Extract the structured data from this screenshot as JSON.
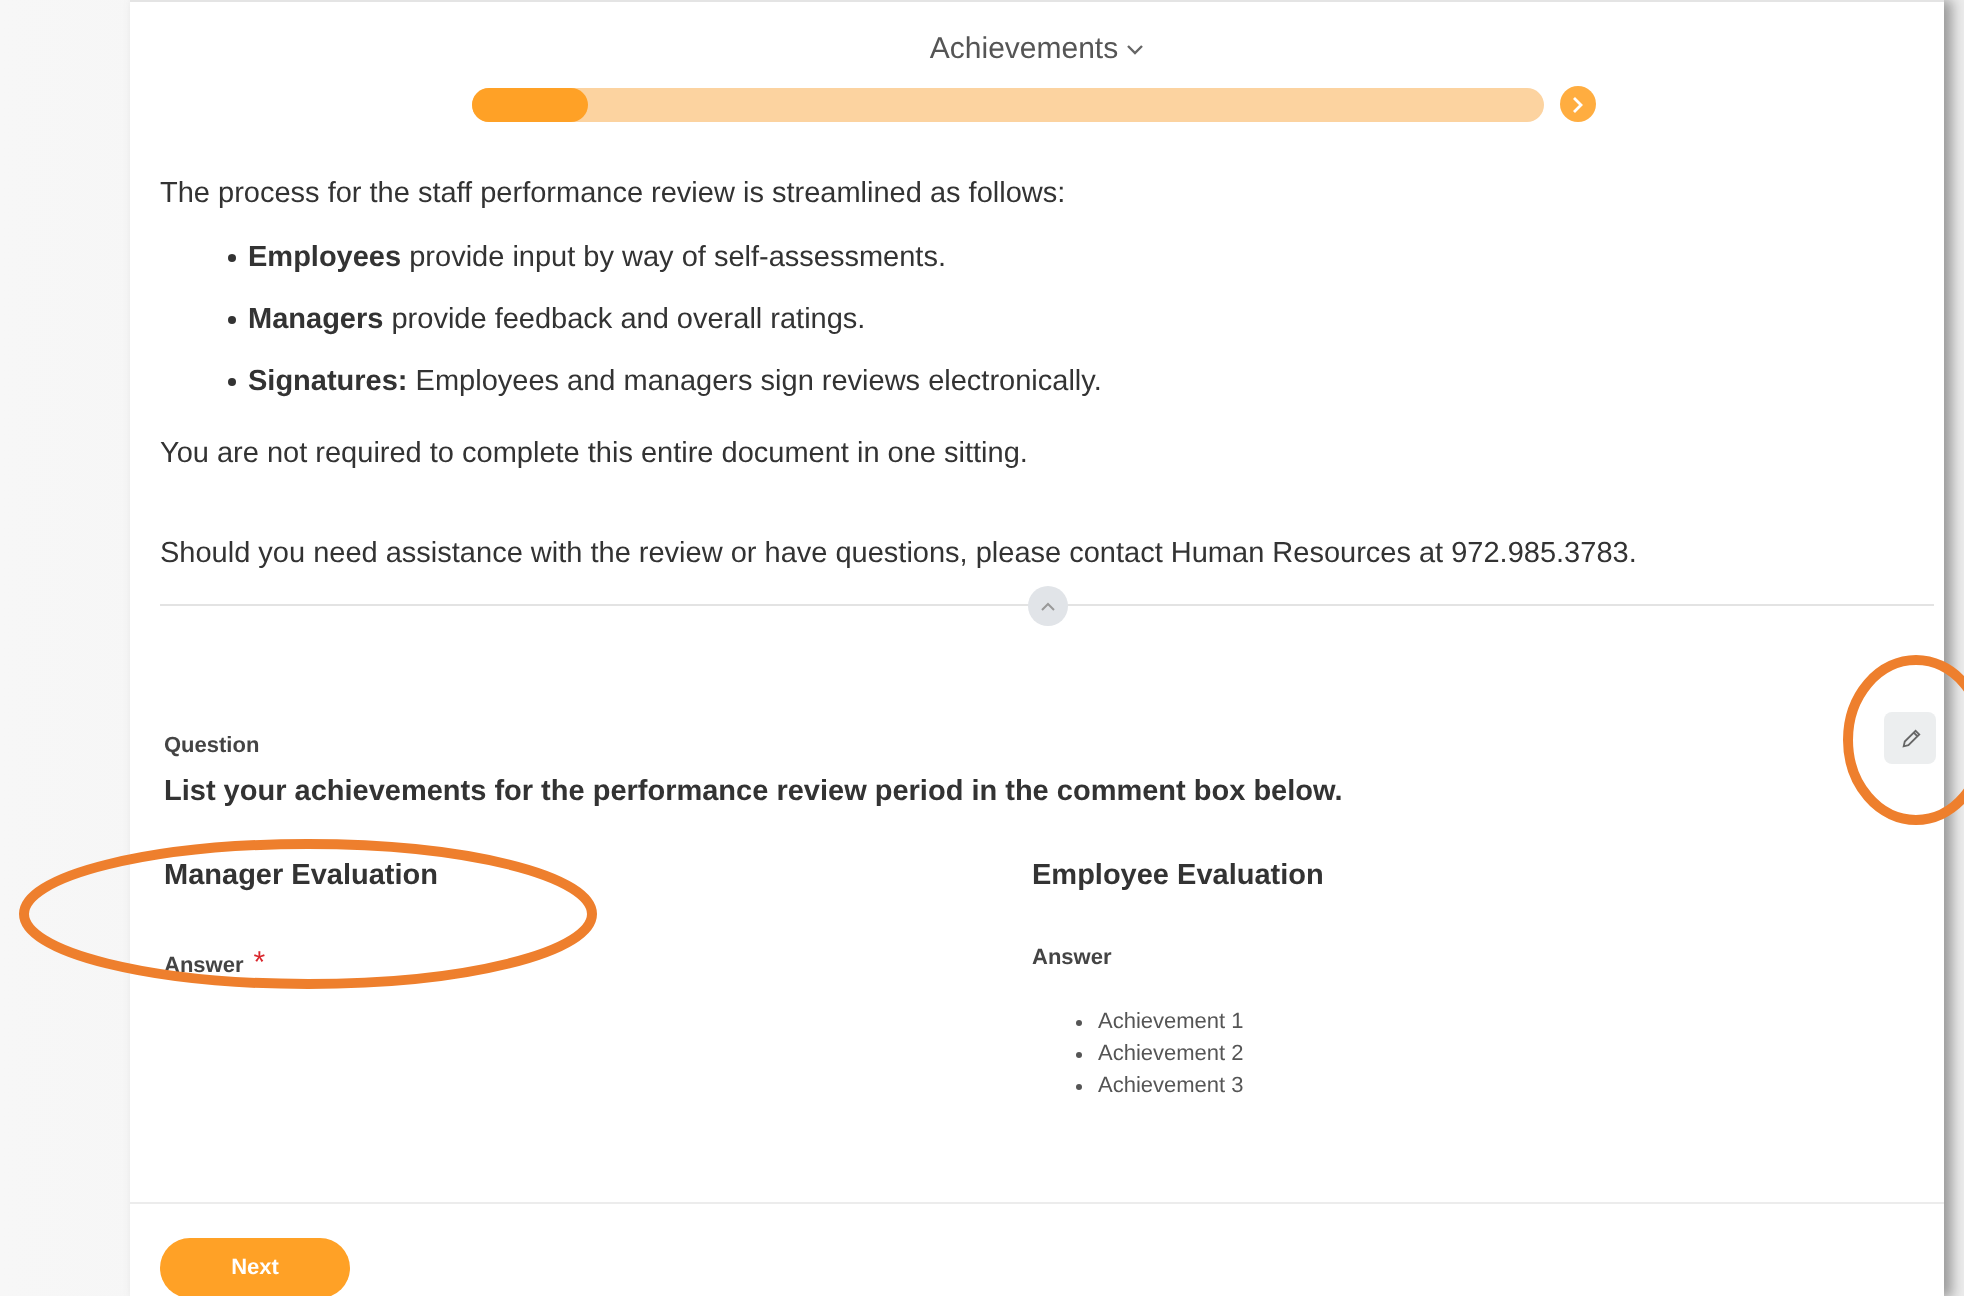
{
  "header": {
    "title": "Achievements",
    "progress": {
      "level": 0.11
    }
  },
  "intro": {
    "lead": "The process for the staff performance review is streamlined as follows:",
    "bullets": [
      "**Employees** provide input by way of self-assessments.",
      "**Managers** provide feedback and overall ratings.",
      "**Signatures:** Employees and managers sign reviews electronically."
    ],
    "paragraphs": [
      "You are not required to complete this entire document in one sitting.",
      "Should you need assistance with the review or have questions, please contact Human Resources at 972.985.3783."
    ]
  },
  "question": {
    "label": "Question",
    "text": "List your achievements for the performance review period in the comment box below."
  },
  "columns": [
    {
      "title": "Manager Evaluation",
      "answer_label": "Answer",
      "required_mark": "*"
    },
    {
      "title": "Employee Evaluation",
      "answer_label": "Answer",
      "items": [
        "Achievement 1",
        "Achievement 2",
        "Achievement 3"
      ]
    }
  ],
  "footer": {
    "button": "Next"
  }
}
